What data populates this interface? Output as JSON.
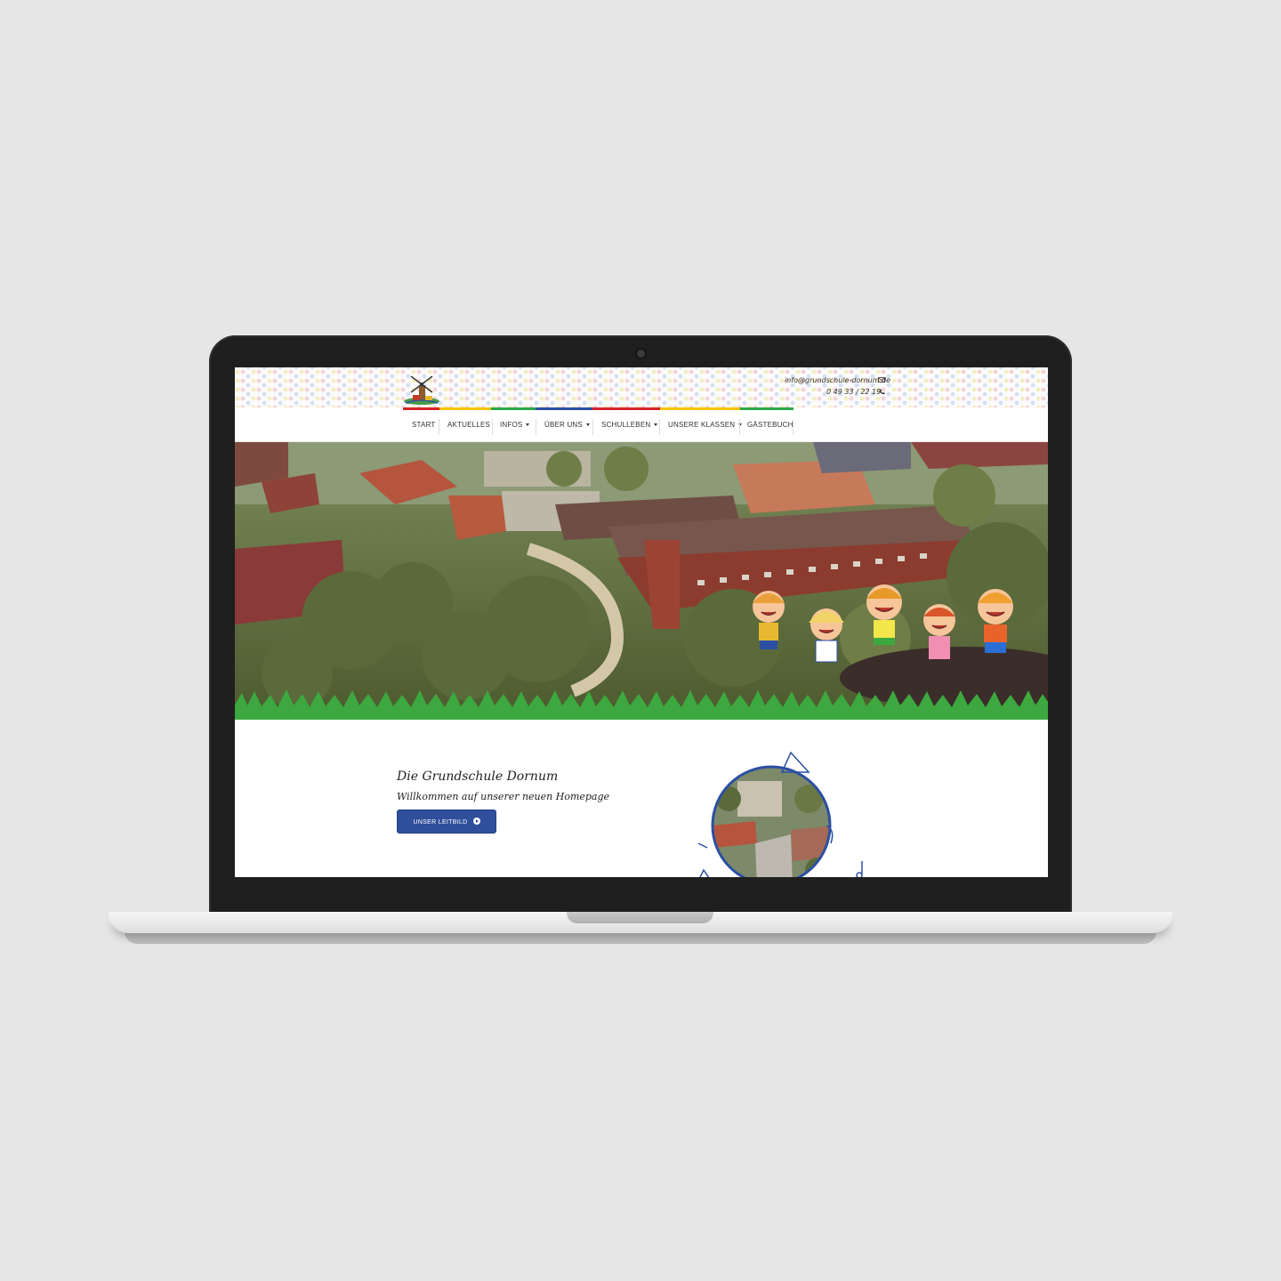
{
  "header": {
    "email": "info@grundschule-dornum.de",
    "phone": "0 49 33 / 22 19",
    "email_icon": "envelope-icon",
    "phone_icon": "phone-icon",
    "logo_icon": "windmill-logo-icon"
  },
  "colors": {
    "strip": [
      "#d8232a",
      "#f2c500",
      "#2aa84a",
      "#2b4fa3",
      "#d8232a",
      "#f2c500",
      "#2aa84a",
      "#2b4fa3",
      "#f2c500"
    ],
    "button": "#2f4e9b",
    "grass": "#3da83f"
  },
  "nav": {
    "items": [
      {
        "label": "START",
        "dropdown": false
      },
      {
        "label": "AKTUELLES",
        "dropdown": false
      },
      {
        "label": "INFOS",
        "dropdown": true
      },
      {
        "label": "ÜBER UNS",
        "dropdown": true
      },
      {
        "label": "SCHULLEBEN",
        "dropdown": true
      },
      {
        "label": "UNSERE KLASSEN",
        "dropdown": true
      },
      {
        "label": "GÄSTEBUCH",
        "dropdown": false
      }
    ]
  },
  "main": {
    "title": "Die Grundschule Dornum",
    "subtitle": "Willkommen auf unserer neuen Homepage",
    "button_label": "UNSER LEITBILD"
  }
}
